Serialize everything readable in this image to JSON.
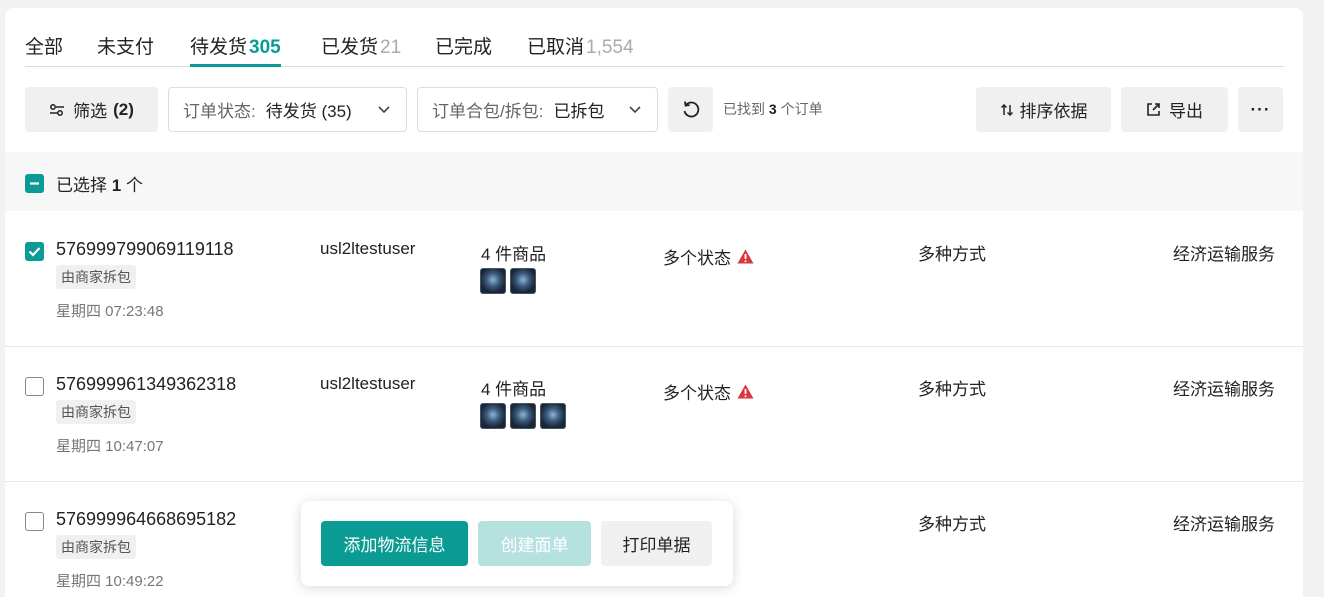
{
  "tabs": [
    {
      "label": "全部",
      "count": ""
    },
    {
      "label": "未支付",
      "count": ""
    },
    {
      "label": "待发货",
      "count": "305"
    },
    {
      "label": "已发货",
      "count": "21"
    },
    {
      "label": "已完成",
      "count": ""
    },
    {
      "label": "已取消",
      "count": "1,554"
    }
  ],
  "toolbar": {
    "filter_label": "筛选",
    "filter_count": "(2)",
    "status_key": "订单状态:",
    "status_value": "待发货 (35)",
    "pack_key": "订单合包/拆包:",
    "pack_value": "已拆包",
    "found_prefix": "已找到",
    "found_count": "3",
    "found_suffix": "个订单",
    "sort_label": "排序依据",
    "export_label": "导出",
    "more_label": "···"
  },
  "selection": {
    "prefix": "已选择",
    "count": "1",
    "suffix": "个"
  },
  "orders": [
    {
      "id": "576999799069119118",
      "tag": "由商家拆包",
      "time": "星期四 07:23:48",
      "user": "usl2ltestuser",
      "items": "4 件商品",
      "status": "多个状态",
      "shipping": "多种方式",
      "service": "经济运输服务",
      "checked": true
    },
    {
      "id": "576999961349362318",
      "tag": "由商家拆包",
      "time": "星期四 10:47:07",
      "user": "usl2ltestuser",
      "items": "4 件商品",
      "status": "多个状态",
      "shipping": "多种方式",
      "service": "经济运输服务",
      "checked": false
    },
    {
      "id": "576999964668695182",
      "tag": "由商家拆包",
      "time": "星期四 10:49:22",
      "user": "",
      "items": "",
      "status": "",
      "shipping": "多种方式",
      "service": "经济运输服务",
      "checked": false
    }
  ],
  "actions": {
    "add_logistics": "添加物流信息",
    "create_label": "创建面单",
    "print_docs": "打印单据"
  },
  "colors": {
    "accent": "#0a9b94",
    "accent_disabled": "#b5e2df",
    "warning": "#d9363e"
  }
}
